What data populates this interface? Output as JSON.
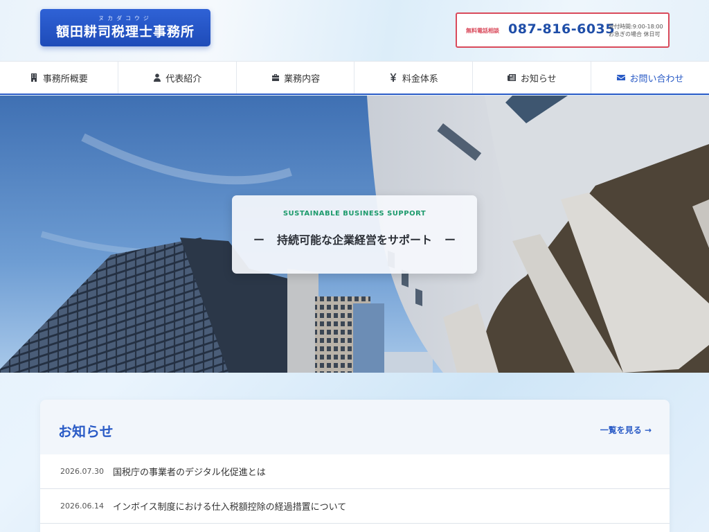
{
  "header": {
    "logo_ruby": "ヌカダコウジ",
    "logo_title": "額田耕司税理士事務所",
    "phone_label": "無料電話相談",
    "phone_number": "087-816-6035",
    "hours_line1": "受付時間:9:00-18:00",
    "hours_line2": "お急ぎの場合 休日可"
  },
  "nav": {
    "items": [
      {
        "label": "事務所概要",
        "icon": "building-icon"
      },
      {
        "label": "代表紹介",
        "icon": "user-icon"
      },
      {
        "label": "業務内容",
        "icon": "briefcase-icon"
      },
      {
        "label": "料金体系",
        "icon": "yen-icon"
      },
      {
        "label": "お知らせ",
        "icon": "newspaper-icon"
      },
      {
        "label": "お問い合わせ",
        "icon": "envelope-icon"
      }
    ]
  },
  "hero": {
    "subtitle": "SUSTAINABLE BUSINESS SUPPORT",
    "dash": "ー",
    "title": "持続可能な企業経営をサポート"
  },
  "news": {
    "heading": "お知らせ",
    "more_link": "一覧を見る →",
    "items": [
      {
        "date": "2026.07.30",
        "title": "国税庁の事業者のデジタル化促進とは"
      },
      {
        "date": "2026.06.14",
        "title": "インボイス制度における仕入税額控除の経過措置について"
      }
    ]
  },
  "colors": {
    "brand_blue": "#2a5bc6",
    "phone_red": "#d9495a",
    "accent_green": "#1d9a6c"
  }
}
